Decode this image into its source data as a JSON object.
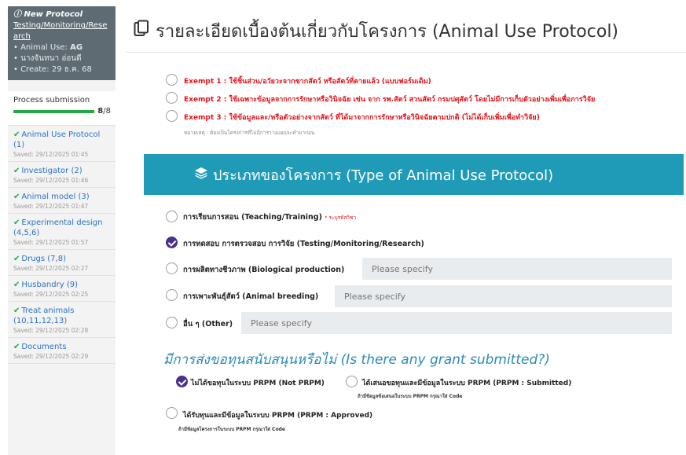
{
  "sidebar": {
    "protocol_title": "New Protocol",
    "protocol_type": "Testing/Monitoring/Research",
    "animal_use_label": "Animal Use:",
    "animal_use_value": "AG",
    "owner": "นางจันทนา อ่อนดี",
    "create": "Create: 29 ธ.ค. 68",
    "process_label": "Process submission",
    "process_done": "8",
    "process_total": "/8",
    "process_fraction": 1.0,
    "steps": [
      {
        "label": "Animal Use Protocol (1)",
        "saved": "Saved: 29/12/2025 01:45"
      },
      {
        "label": "Investigator (2)",
        "saved": "Saved: 29/12/2025 01:46"
      },
      {
        "label": "Animal model (3)",
        "saved": "Saved: 29/12/2025 01:47"
      },
      {
        "label": "Experimental design (4,5,6)",
        "saved": "Saved: 29/12/2025 01:57"
      },
      {
        "label": "Drugs (7,8)",
        "saved": "Saved: 29/12/2025 02:27"
      },
      {
        "label": "Husbandry (9)",
        "saved": "Saved: 29/12/2025 02:25"
      },
      {
        "label": "Treat animals (10,11,12,13)",
        "saved": "Saved: 29/12/2025 02:28"
      },
      {
        "label": "Documents",
        "saved": "Saved: 29/12/2025 02:29"
      }
    ]
  },
  "header": {
    "title": "รายละเอียดเบื้องต้นเกี่ยวกับโครงการ (Animal Use Protocol)"
  },
  "exempt": {
    "items": [
      "Exempt 1 : ใช้ชิ้นส่วน/อวัยวะจากซากสัตว์ หรือสัตว์ที่ตายแล้ว (แบบฟอร์มเดิม)",
      "Exempt 2 : ใช้เฉพาะข้อมูลจากการรักษาหรือวินิจฉัย เช่น จาก รพ.สัตว์ สวนสัตว์ กรมปศุสัตว์ โดยไม่มีการเก็บตัวอย่างเพิ่มเพื่อการวิจัย",
      "Exempt 3 : ใช้ข้อมูลและ/หรือตัวอย่างจากสัตว์ ที่ได้มาจากการรักษาหรือวินิจฉัยตามปกติ (ไม่ได้เก็บเพิ่มเพื่อทำวิจัย)"
    ],
    "note": "หมายเหตุ : ต้องเป็นโครงการที่ไม่มีการวางแผนจะทำมาก่อน"
  },
  "type_section": {
    "title": "ประเภทของโครงการ (Type of Animal Use Protocol)",
    "options": [
      {
        "label": "การเรียนการสอน (Teaching/Training)",
        "required": "* ระบุรหัสวิชา",
        "checked": false
      },
      {
        "label": "การทดสอบ การตรวจสอบ การวิจัย (Testing/Monitoring/Research)",
        "checked": true
      },
      {
        "label": "การผลิตทางชีวภาพ (Biological production)",
        "placeholder": "Please specify",
        "checked": false
      },
      {
        "label": "การเพาะพันธุ์สัตว์ (Animal breeding)",
        "placeholder": "Please specify",
        "checked": false
      },
      {
        "label": "อื่น ๆ (Other)",
        "placeholder": "Please specify",
        "checked": false
      }
    ]
  },
  "grant": {
    "title": "มีการส่งขอทุนสนับสนุนหรือไม่ (Is there any grant submitted?)",
    "options": [
      {
        "label": "ไม่ได้ขอทุนในระบบ PRPM (Not PRPM)",
        "checked": true
      },
      {
        "label": "ได้เสนอขอทุนและมีข้อมูลในระบบ PRPM (PRPM : Submitted)",
        "note": "ถ้ามีข้อมูลข้อเสนอในระบบ PRPM กรุณาใส่ Code",
        "checked": false
      },
      {
        "label": "ได้รับทุนและมีข้อมูลในระบบ PRPM (PRPM : Approved)",
        "note": "ถ้ามีข้อมูลโครงการในระบบ PRPM กรุณาใส่ Code",
        "checked": false
      }
    ]
  },
  "colors": {
    "sidebar_header": "#5f6b73",
    "accent_teal": "#1f9bb8",
    "link_blue": "#2c72c7",
    "success_green": "#28a745",
    "exempt_red": "#e0141a",
    "radio_checked": "#4a2f8f"
  },
  "icons": {
    "header": "clipboard-icon",
    "type_section": "layers-icon",
    "protocol": "info-circle-icon",
    "step": "check-icon"
  }
}
